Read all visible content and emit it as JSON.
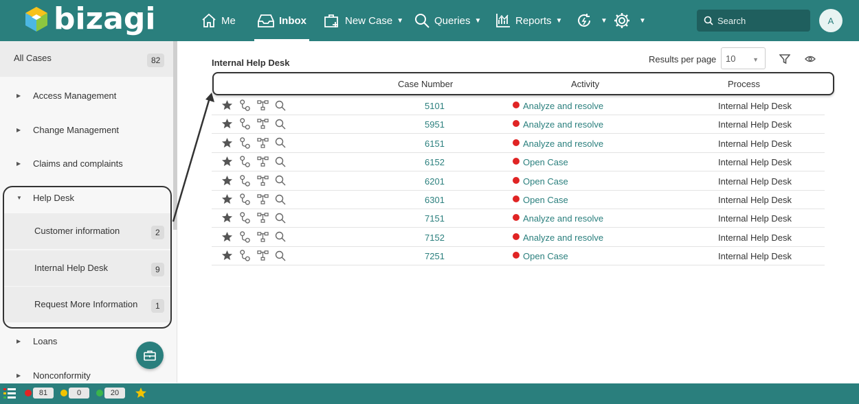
{
  "app": {
    "brand": "bizagi",
    "accent": "#2a7f7d"
  },
  "nav": {
    "me": "Me",
    "inbox": "Inbox",
    "new_case": "New Case",
    "queries": "Queries",
    "reports": "Reports"
  },
  "search": {
    "placeholder": "Search"
  },
  "user": {
    "initial": "A"
  },
  "sidebar": {
    "all_cases": {
      "label": "All Cases",
      "count": "82"
    },
    "items": [
      {
        "label": "Access Management"
      },
      {
        "label": "Change Management"
      },
      {
        "label": "Claims and complaints"
      },
      {
        "label": "Help Desk"
      },
      {
        "label": "Loans"
      },
      {
        "label": "Nonconformity"
      }
    ],
    "help_desk_children": [
      {
        "label": "Customer information",
        "count": "2"
      },
      {
        "label": "Internal Help Desk",
        "count": "9"
      },
      {
        "label": "Request More Information",
        "count": "1"
      }
    ]
  },
  "main": {
    "title": "Internal Help Desk",
    "results_per_page_label": "Results per page",
    "results_per_page_value": "10",
    "columns": {
      "case_number": "Case Number",
      "activity": "Activity",
      "process": "Process"
    },
    "rows": [
      {
        "case": "5101",
        "activity": "Analyze and resolve",
        "process": "Internal Help Desk"
      },
      {
        "case": "5951",
        "activity": "Analyze and resolve",
        "process": "Internal Help Desk"
      },
      {
        "case": "6151",
        "activity": "Analyze and resolve",
        "process": "Internal Help Desk"
      },
      {
        "case": "6152",
        "activity": "Open Case",
        "process": "Internal Help Desk"
      },
      {
        "case": "6201",
        "activity": "Open Case",
        "process": "Internal Help Desk"
      },
      {
        "case": "6301",
        "activity": "Open Case",
        "process": "Internal Help Desk"
      },
      {
        "case": "7151",
        "activity": "Analyze and resolve",
        "process": "Internal Help Desk"
      },
      {
        "case": "7152",
        "activity": "Analyze and resolve",
        "process": "Internal Help Desk"
      },
      {
        "case": "7251",
        "activity": "Open Case",
        "process": "Internal Help Desk"
      }
    ]
  },
  "bottom": {
    "red": "81",
    "yellow": "0",
    "green": "20",
    "colors": {
      "red": "#e02424",
      "yellow": "#f2c300",
      "green": "#3bb54a",
      "star": "#f2c300"
    }
  }
}
